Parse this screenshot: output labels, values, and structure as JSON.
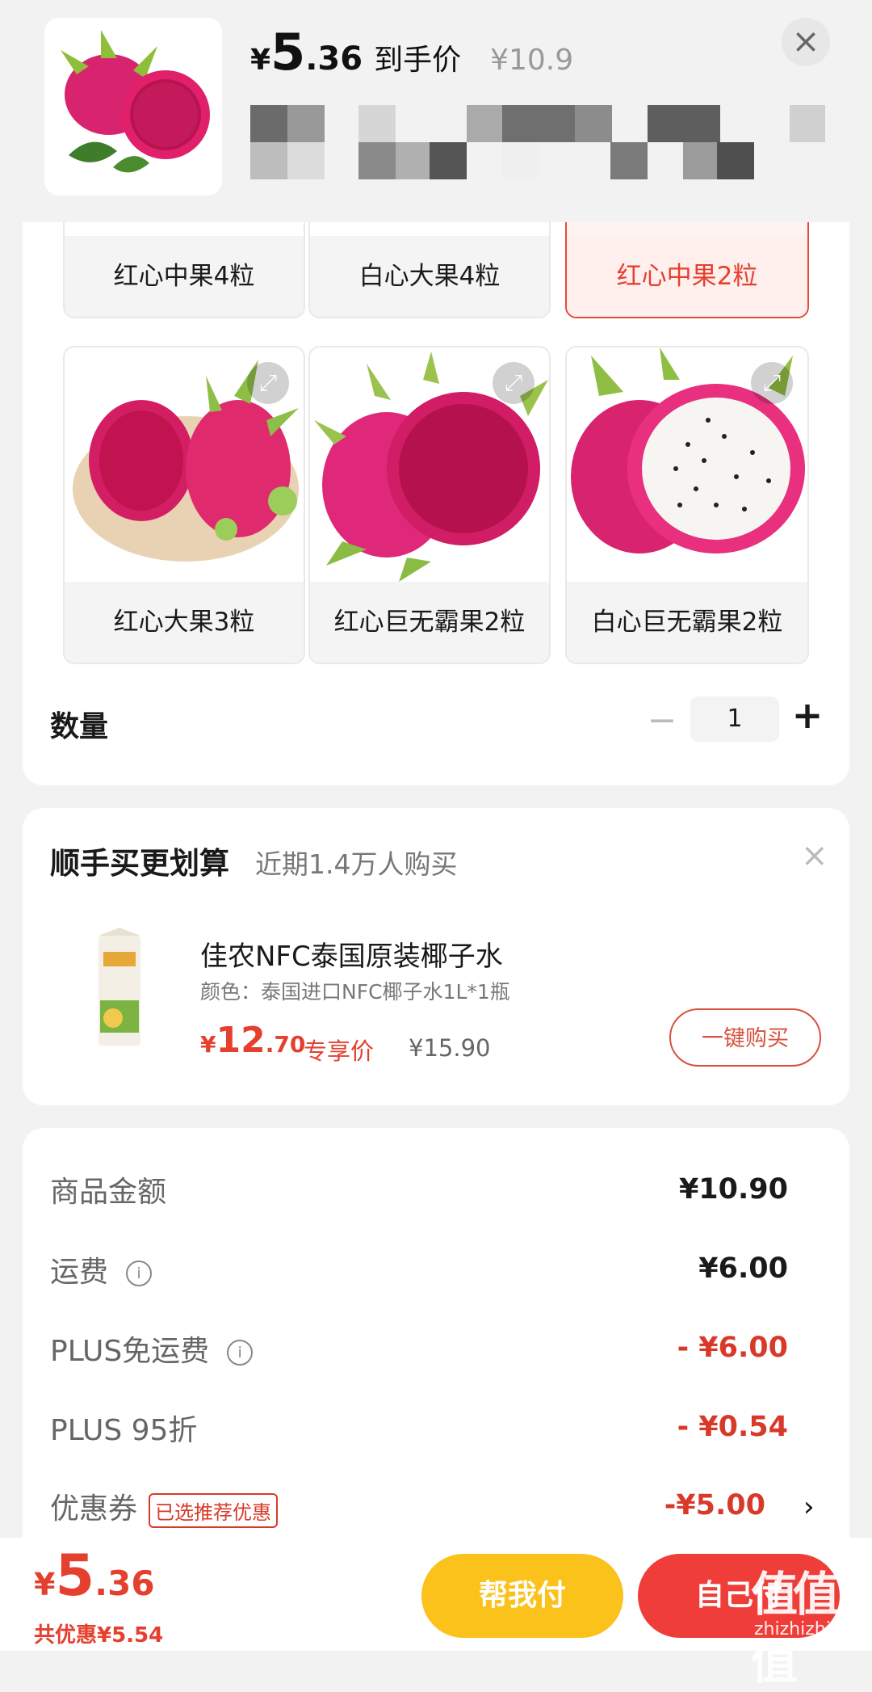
{
  "header": {
    "price_currency": "¥",
    "price_int": "5",
    "price_dec": ".36",
    "price_label": "到手价",
    "original_price": "¥10.9",
    "close_symbol": "×"
  },
  "spec_options": [
    {
      "label": "红心中果4粒",
      "selected": false
    },
    {
      "label": "白心大果4粒",
      "selected": false
    },
    {
      "label": "红心中果2粒",
      "selected": true
    },
    {
      "label": "红心大果3粒",
      "selected": false
    },
    {
      "label": "红心巨无霸果2粒",
      "selected": false
    },
    {
      "label": "白心巨无霸果2粒",
      "selected": false
    }
  ],
  "expand_symbol": "⤢",
  "quantity": {
    "label": "数量",
    "minus": "−",
    "value": "1",
    "plus": "+"
  },
  "addon": {
    "title": "顺手买更划算",
    "subtitle": "近期1.4万人购买",
    "close_symbol": "×",
    "product_name": "佳农NFC泰国原装椰子水",
    "product_spec": "颜色：泰国进口NFC椰子水1L*1瓶",
    "price_currency": "¥",
    "price_int": "12",
    "price_dec": ".70",
    "exclusive_label": "专享价",
    "original_price": "¥15.90",
    "buy_button": "一键购买"
  },
  "breakdown": [
    {
      "label": "商品金额",
      "value": "¥10.90",
      "red": false
    },
    {
      "label": "运费",
      "value": "¥6.00",
      "red": false,
      "info": true
    },
    {
      "label": "PLUS免运费",
      "value": "- ¥6.00",
      "red": true,
      "info": true
    },
    {
      "label": "PLUS 95折",
      "value": "- ¥0.54",
      "red": true
    },
    {
      "label": "优惠券",
      "value": "-¥5.00",
      "red": true,
      "tag": "已选推荐优惠"
    }
  ],
  "info_symbol": "i",
  "chevron_symbol": "›",
  "bottom_bar": {
    "total_currency": "¥",
    "total_int": "5",
    "total_dec": ".36",
    "savings": "共优惠¥5.54",
    "help_pay": "帮我付",
    "self_pay": "自己付"
  },
  "watermark": {
    "main": "值值值",
    "sub": "zhizhizhi.com"
  },
  "colors": {
    "accent_red": "#e5402f",
    "help_yellow": "#fbc21c",
    "self_red": "#ef3d3a"
  }
}
